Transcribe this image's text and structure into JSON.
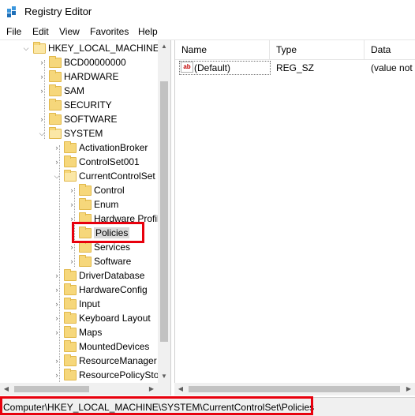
{
  "window": {
    "title": "Registry Editor"
  },
  "menu": [
    "File",
    "Edit",
    "View",
    "Favorites",
    "Help"
  ],
  "tree": {
    "items": [
      {
        "label": "HKEY_LOCAL_MACHINE",
        "expanded": true
      },
      {
        "label": "BCD00000000"
      },
      {
        "label": "HARDWARE"
      },
      {
        "label": "SAM"
      },
      {
        "label": "SECURITY"
      },
      {
        "label": "SOFTWARE"
      },
      {
        "label": "SYSTEM",
        "expanded": true
      },
      {
        "label": "ActivationBroker"
      },
      {
        "label": "ControlSet001"
      },
      {
        "label": "CurrentControlSet",
        "expanded": true
      },
      {
        "label": "Control"
      },
      {
        "label": "Enum"
      },
      {
        "label": "Hardware Profiles"
      },
      {
        "label": "Policies",
        "selected": true
      },
      {
        "label": "Services"
      },
      {
        "label": "Software"
      },
      {
        "label": "DriverDatabase"
      },
      {
        "label": "HardwareConfig"
      },
      {
        "label": "Input"
      },
      {
        "label": "Keyboard Layout"
      },
      {
        "label": "Maps"
      },
      {
        "label": "MountedDevices"
      },
      {
        "label": "ResourceManager"
      },
      {
        "label": "ResourcePolicyStore"
      }
    ]
  },
  "list": {
    "columns": {
      "name": "Name",
      "type": "Type",
      "data": "Data"
    },
    "rows": [
      {
        "name": "(Default)",
        "type": "REG_SZ",
        "data": "(value not set)"
      }
    ]
  },
  "status": {
    "path": "Computer\\HKEY_LOCAL_MACHINE\\SYSTEM\\CurrentControlSet\\Policies"
  },
  "icons": {
    "app": "registry-editor-icon",
    "folder": "folder-icon",
    "string_value": "string-value-icon",
    "expand": "chevron-right-icon",
    "collapse": "chevron-down-icon"
  },
  "colors": {
    "highlight": "#e8000d",
    "folder": "#f6d77b",
    "selection": "#d9d9d9"
  }
}
